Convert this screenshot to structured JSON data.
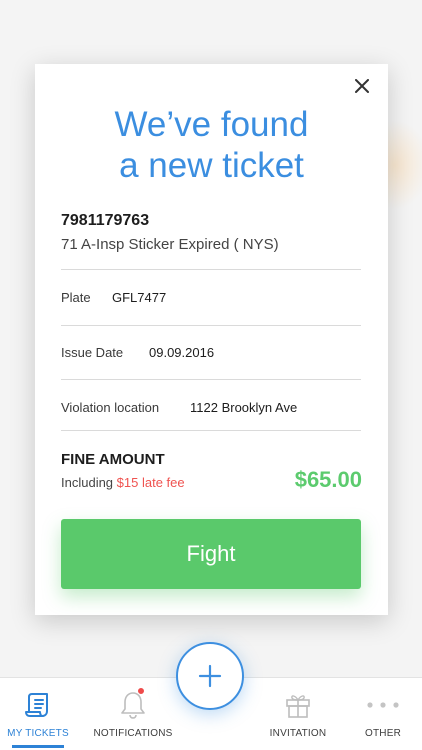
{
  "modal": {
    "title_line1": "We’ve found",
    "title_line2": "a new ticket",
    "ticket_number": "7981179763",
    "violation_desc": "71 A-Insp Sticker Expired ( NYS)",
    "rows": [
      {
        "label": "Plate",
        "value": "GFL7477"
      },
      {
        "label": "Issue Date",
        "value": "09.09.2016"
      },
      {
        "label": "Violation location",
        "value": "1122 Brooklyn Ave"
      }
    ],
    "fine_title": "FINE AMOUNT",
    "fine_including": "Including",
    "late_fee": "$15 late fee",
    "fine_amount": "$65.00",
    "fight_label": "Fight",
    "close_icon": "close-icon"
  },
  "tabbar": {
    "tabs": [
      {
        "label": "MY TICKETS",
        "icon": "ticket-scroll-icon",
        "active": true
      },
      {
        "label": "NOTIFICATIONS",
        "icon": "bell-icon",
        "badge": true
      },
      {
        "label": "INVITATION",
        "icon": "gift-icon"
      },
      {
        "label": "OTHER",
        "icon": "more-dots-icon"
      }
    ],
    "fab_icon": "plus-icon"
  },
  "colors": {
    "accent_blue": "#3b8ee0",
    "green": "#5ac96b",
    "red": "#ef5350"
  }
}
